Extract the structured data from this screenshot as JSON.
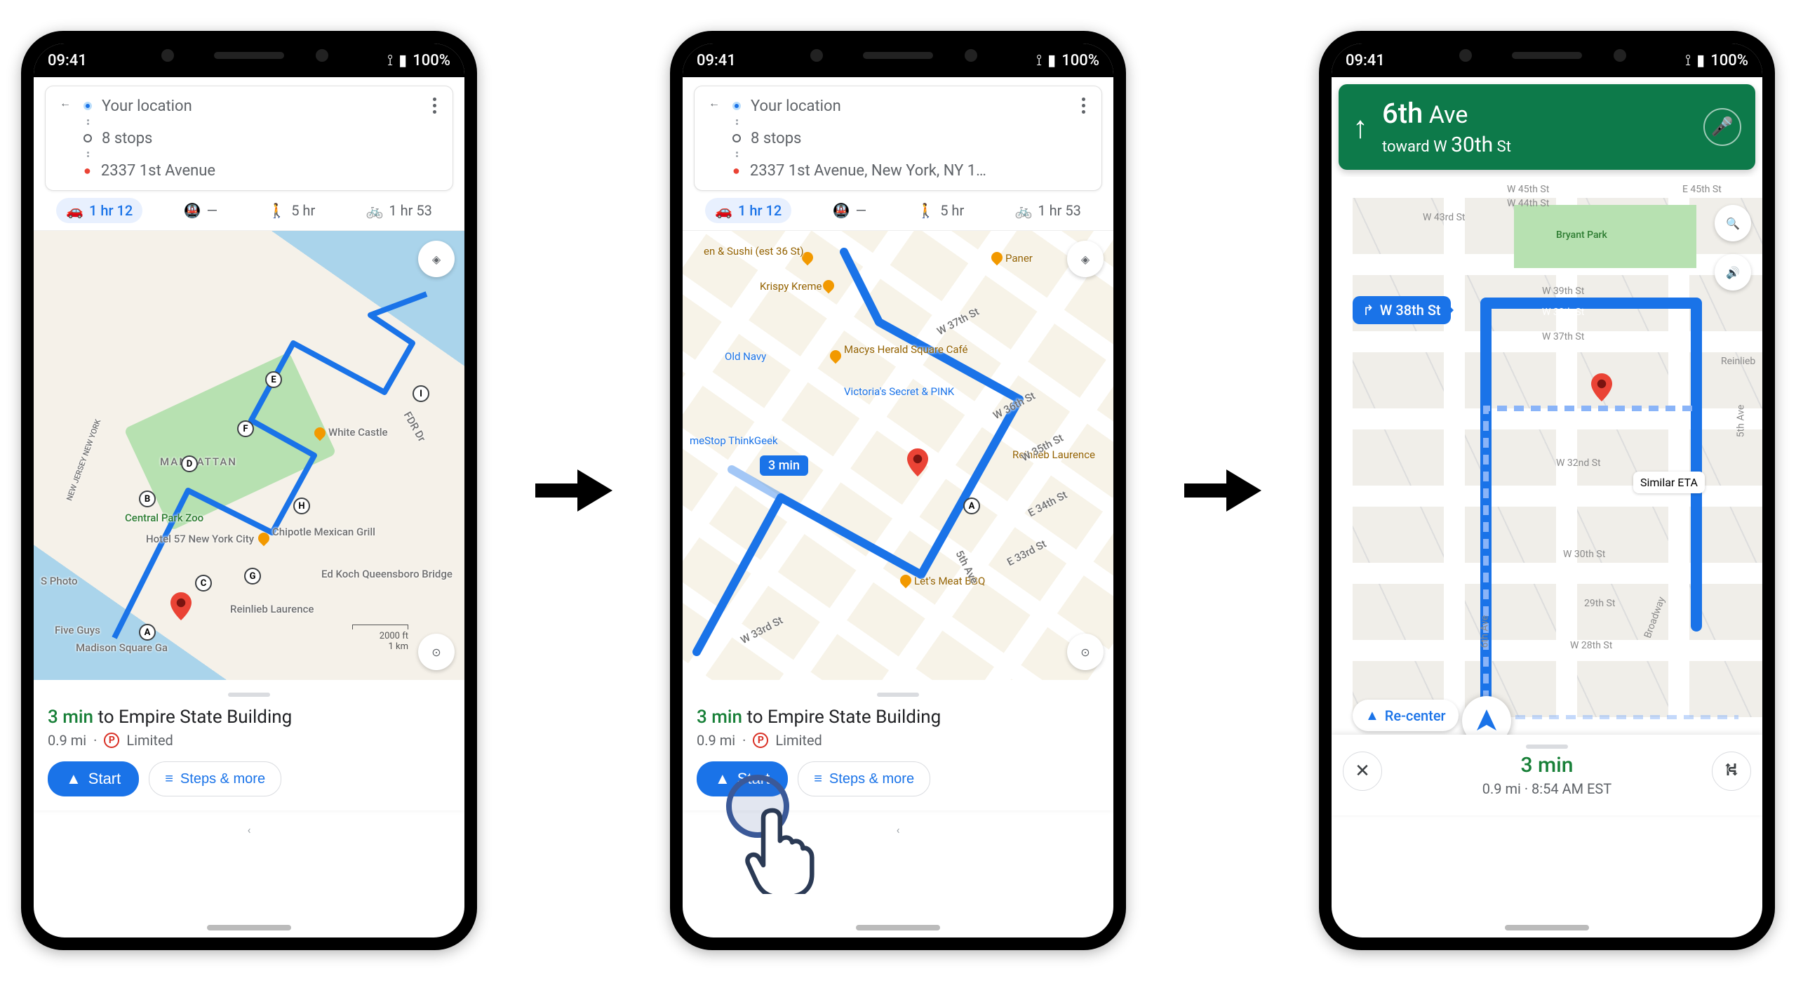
{
  "status": {
    "time": "09:41",
    "battery": "100%"
  },
  "search": {
    "origin": "Your location",
    "stops": "8 stops",
    "destination_short": "2337 1st Avenue",
    "destination_long": "2337 1st Avenue, New York, NY 1…"
  },
  "modes": {
    "drive": "1 hr 12",
    "transit": "—",
    "walk": "5 hr",
    "bike": "1 hr 53"
  },
  "sheet": {
    "eta": "3 min",
    "to_label": " to Empire State Building",
    "distance": "0.9 mi",
    "parking": "Limited",
    "start": "Start",
    "steps": "Steps & more"
  },
  "map1": {
    "pois": {
      "white_castle": "White Castle",
      "central_park_zoo": "Central Park Zoo",
      "hotel57": "Hotel 57 New York City",
      "chipotle": "Chipotle Mexican Grill",
      "edkoch": "Ed Koch Queensboro Bridge",
      "reinlieb": "Reinlieb Laurence",
      "fiveguys": "Five Guys",
      "msg": "Madison Square Ga",
      "nj": "NEW JERSEY  NEW YORK",
      "manhattan": "MANHATTAN",
      "sphoto": "S Photo",
      "fdr": "FDR Dr"
    },
    "stops": [
      "A",
      "B",
      "C",
      "D",
      "E",
      "F",
      "G",
      "H",
      "I"
    ],
    "scale": {
      "ft": "2000 ft",
      "km": "1 km"
    }
  },
  "map2": {
    "eta_bubble": "3 min",
    "stop_a": "A",
    "pois": {
      "ensushi": "en & Sushi (est 36 St)",
      "krispy": "Krispy Kreme",
      "paner": "Paner",
      "oldnavy": "Old Navy",
      "macys": "Macys Herald Square Café",
      "vs": "Victoria's Secret & PINK",
      "gamestop": "meStop ThinkGeek",
      "reinlieb": "Reinlieb Laurence",
      "letsmeat": "Let's Meat BBQ"
    },
    "streets": {
      "w37": "W 37th St",
      "w36": "W 36th St",
      "w35": "W 35th St",
      "e34": "E 34th St",
      "e33": "E 33rd St",
      "w33": "W 33rd St",
      "fifth": "5th Ave"
    }
  },
  "nav": {
    "street_main": "6th",
    "street_suffix": " Ave",
    "toward_prefix": "toward W ",
    "toward_main": "30th",
    "toward_suffix": " St",
    "next_turn": "W 38th St",
    "sim_eta": "Similar ETA",
    "recenter": "Re-center",
    "bottom_time": "3 min",
    "bottom_sub": "0.9 mi  ·  8:54 AM EST",
    "park_label": "Bryant Park",
    "streets": {
      "w45": "W 45th St",
      "w44": "W 44th St",
      "w43": "W 43rd St",
      "e45": "E 45th St",
      "w39": "W 39th St",
      "w38": "W 38th St",
      "w37": "W 37th St",
      "w32": "W 32nd St",
      "w30": "W 30th St",
      "n29": "29th St",
      "w28": "W 28th St",
      "reinlieb": "Reinlieb",
      "fifth": "5th Ave",
      "sixth": "6th Ave",
      "broadway": "Broadway"
    }
  }
}
